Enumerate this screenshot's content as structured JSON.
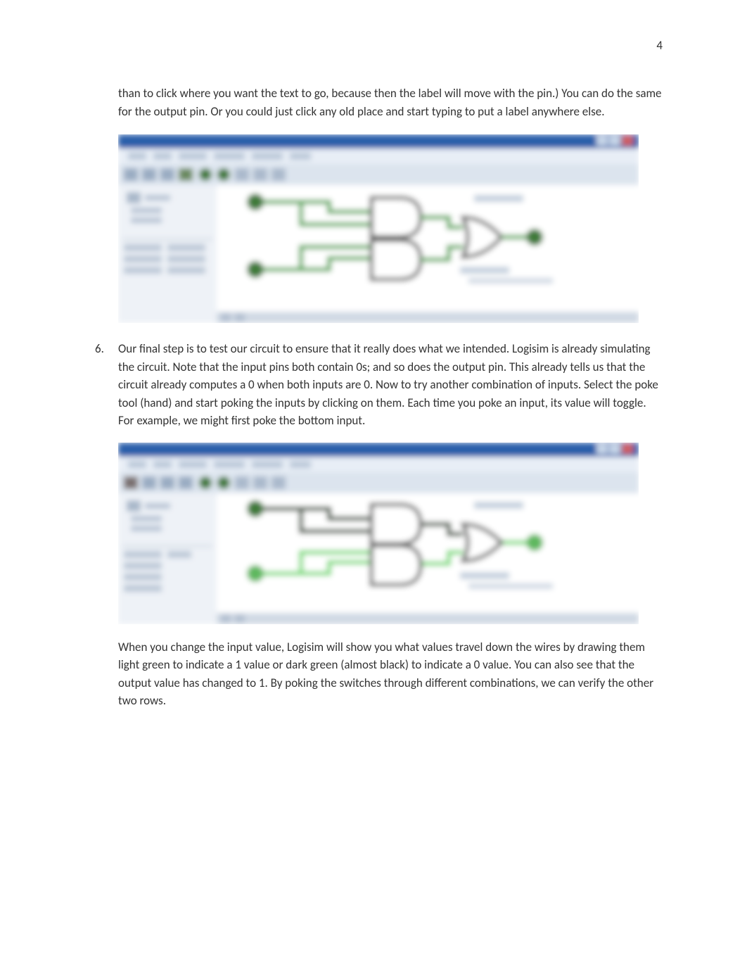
{
  "page_number": "4",
  "paragraphs": {
    "p1": "than to click where you want the text to go, because then the label will move with the pin.) You can do the same for the output pin. Or you could just click any old place and start typing to put a label anywhere else.",
    "p2": "When you change the input value, Logisim will show you what values travel down the wires by drawing them light green to indicate a 1 value or dark green (almost black) to indicate a 0 value. You can also see that the output value has changed to 1. By poking the switches through different combinations, we can verify the other two rows."
  },
  "list": {
    "item6": {
      "number": "6.",
      "text": "Our final step is to test our circuit to ensure that it really does what we intended. Logisim is already simulating the circuit. Note that the input pins both contain 0s; and so does the output pin. This already tells us that the circuit already computes a 0 when both inputs are 0. Now to try another combination of inputs. Select the poke tool (hand) and start poking the inputs by clicking on them. Each time you poke an input, its value will toggle. For example, we might first poke the bottom input."
    }
  }
}
